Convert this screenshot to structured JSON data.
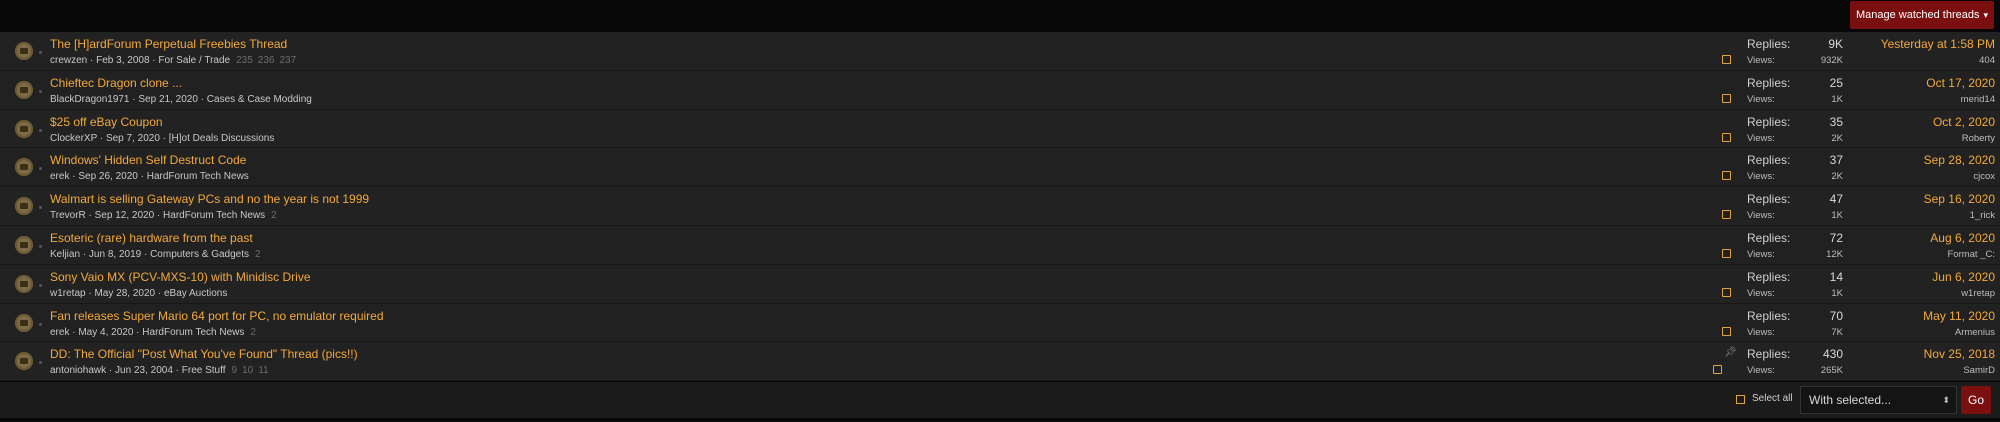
{
  "header": {
    "manage_label": "Manage watched threads",
    "manage_caret": "▾"
  },
  "threads": [
    {
      "title": "The [H]ardForum Perpetual Freebies Thread",
      "author": "crewzen",
      "date": "Feb 3, 2008",
      "forum": "For Sale / Trade",
      "pages": [
        "235",
        "236",
        "237"
      ],
      "replies": "9K",
      "views": "932K",
      "last_date": "Yesterday at 1:58 PM",
      "last_user": "404",
      "pinned": false
    },
    {
      "title": "Chieftec Dragon clone ...",
      "author": "BlackDragon1971",
      "date": "Sep 21, 2020",
      "forum": "Cases & Case Modding",
      "pages": [],
      "replies": "25",
      "views": "1K",
      "last_date": "Oct 17, 2020",
      "last_user": "merid14",
      "pinned": false
    },
    {
      "title": "$25 off eBay Coupon",
      "author": "ClockerXP",
      "date": "Sep 7, 2020",
      "forum": "[H]ot Deals Discussions",
      "pages": [],
      "replies": "35",
      "views": "2K",
      "last_date": "Oct 2, 2020",
      "last_user": "Roberty",
      "pinned": false
    },
    {
      "title": "Windows' Hidden Self Destruct Code",
      "author": "erek",
      "date": "Sep 26, 2020",
      "forum": "HardForum Tech News",
      "pages": [],
      "replies": "37",
      "views": "2K",
      "last_date": "Sep 28, 2020",
      "last_user": "cjcox",
      "pinned": false
    },
    {
      "title": "Walmart is selling Gateway PCs and no the year is not 1999",
      "author": "TrevorR",
      "date": "Sep 12, 2020",
      "forum": "HardForum Tech News",
      "pages": [
        "2"
      ],
      "replies": "47",
      "views": "1K",
      "last_date": "Sep 16, 2020",
      "last_user": "1_rick",
      "pinned": false
    },
    {
      "title": "Esoteric (rare) hardware from the past",
      "author": "Keljian",
      "date": "Jun 8, 2019",
      "forum": "Computers & Gadgets",
      "pages": [
        "2"
      ],
      "replies": "72",
      "views": "12K",
      "last_date": "Aug 6, 2020",
      "last_user": "Format _C:",
      "pinned": false
    },
    {
      "title": "Sony Vaio MX (PCV-MXS-10) with Minidisc Drive",
      "author": "w1retap",
      "date": "May 28, 2020",
      "forum": "eBay Auctions",
      "pages": [],
      "replies": "14",
      "views": "1K",
      "last_date": "Jun 6, 2020",
      "last_user": "w1retap",
      "pinned": false
    },
    {
      "title": "Fan releases Super Mario 64 port for PC, no emulator required",
      "author": "erek",
      "date": "May 4, 2020",
      "forum": "HardForum Tech News",
      "pages": [
        "2"
      ],
      "replies": "70",
      "views": "7K",
      "last_date": "May 11, 2020",
      "last_user": "Armenius",
      "pinned": false
    },
    {
      "title": "DD: The Official \"Post What You've Found\" Thread (pics!!)",
      "author": "antoniohawk",
      "date": "Jun 23, 2004",
      "forum": "Free Stuff",
      "pages": [
        "9",
        "10",
        "11"
      ],
      "replies": "430",
      "views": "265K",
      "last_date": "Nov 25, 2018",
      "last_user": "SamirD",
      "pinned": true
    }
  ],
  "labels": {
    "replies": "Replies:",
    "views": "Views:",
    "sep": " · "
  },
  "footer": {
    "select_all": "Select all",
    "with_selected": "With selected...",
    "go": "Go"
  },
  "colors": {
    "accent": "#f3a93c",
    "button": "#7a0f0f",
    "row_bg": "#212121"
  },
  "icons": {
    "avatar": "thread-avatar-icon",
    "pin": "pin-icon",
    "caret": "chevron-down-icon"
  }
}
